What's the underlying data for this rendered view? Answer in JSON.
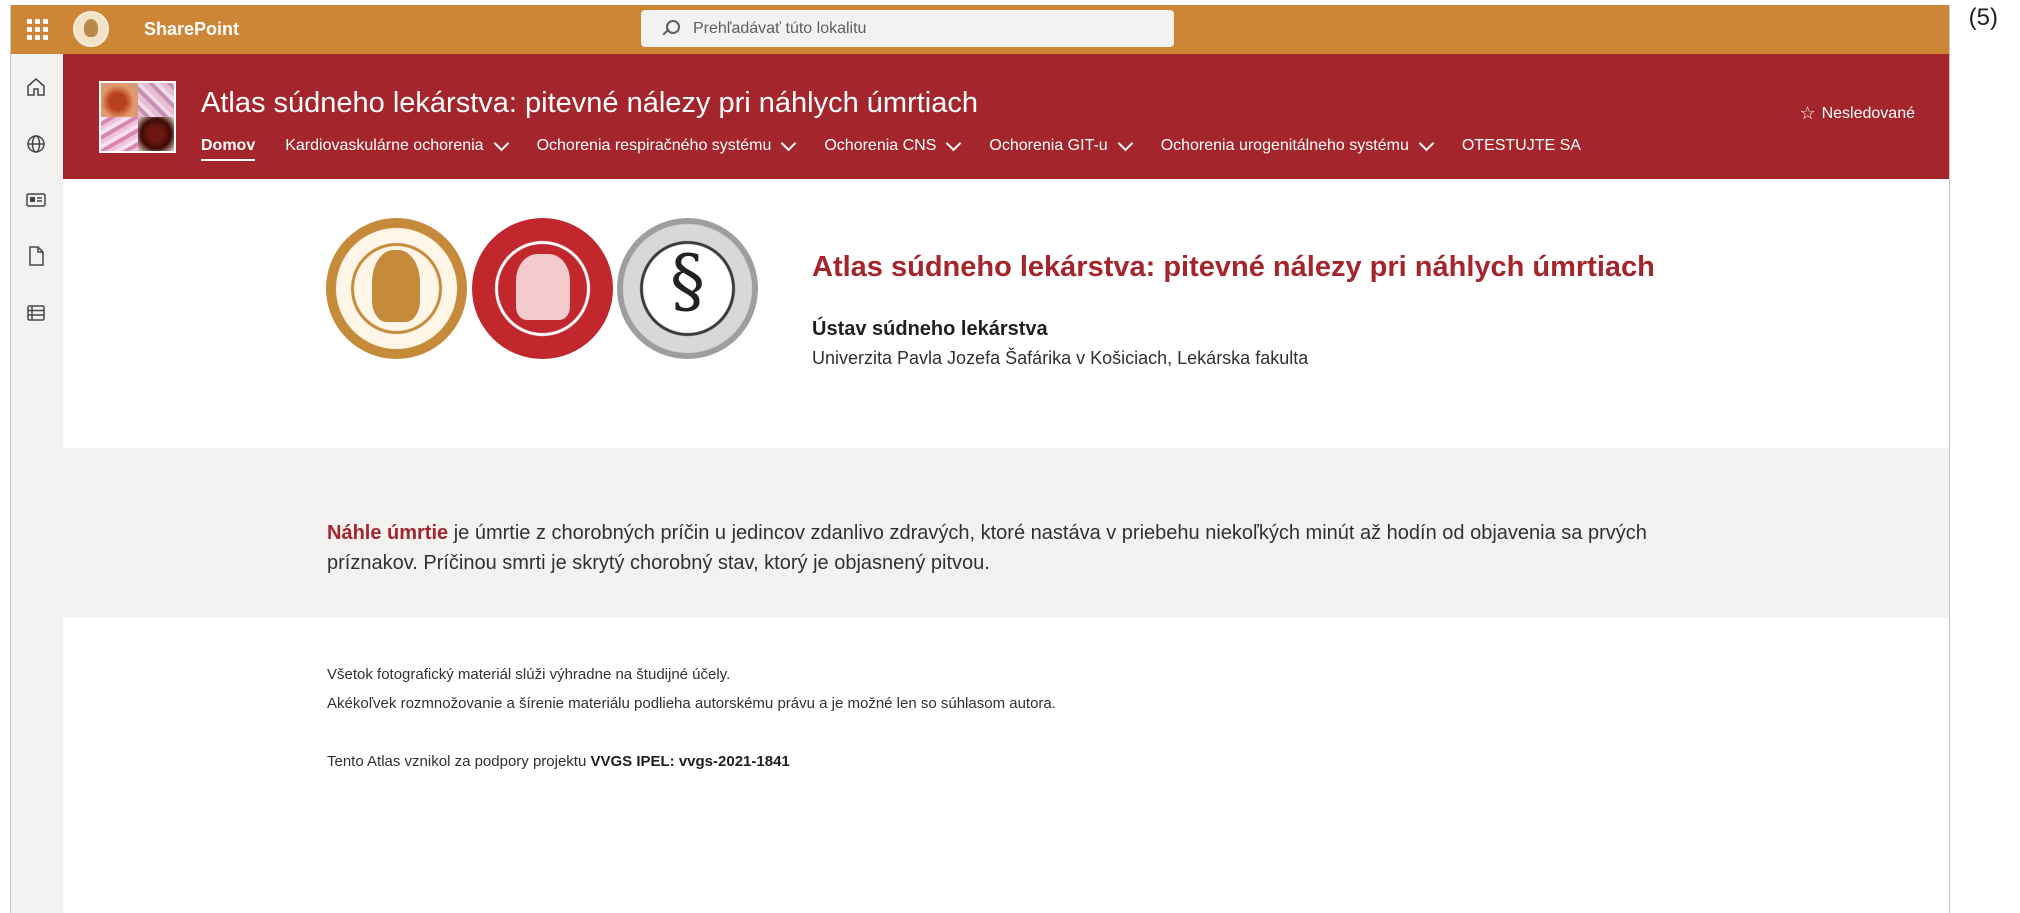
{
  "page_number": "(5)",
  "suite_bar": {
    "app_name": "SharePoint",
    "search_placeholder": "Prehľadávať túto lokalitu",
    "color": "#cd8536"
  },
  "app_bar": {
    "icons": [
      "home-icon",
      "globe-icon",
      "news-icon",
      "file-icon",
      "list-icon"
    ]
  },
  "header": {
    "site_title": "Atlas súdneho lekárstva: pitevné nálezy pri náhlych úmrtiach",
    "color": "#a4262c",
    "nav": [
      {
        "label": "Domov",
        "active": true,
        "dropdown": false
      },
      {
        "label": "Kardiovaskulárne ochorenia",
        "active": false,
        "dropdown": true
      },
      {
        "label": "Ochorenia respiračného systému",
        "active": false,
        "dropdown": true
      },
      {
        "label": "Ochorenia CNS",
        "active": false,
        "dropdown": true
      },
      {
        "label": "Ochorenia GIT-u",
        "active": false,
        "dropdown": true
      },
      {
        "label": "Ochorenia urogenitálneho systému",
        "active": false,
        "dropdown": true
      },
      {
        "label": "OTESTUJTE SA",
        "active": false,
        "dropdown": false
      }
    ],
    "follow_label": "Nesledované"
  },
  "hero": {
    "title": "Atlas súdneho lekárstva: pitevné nálezy pri náhlych úmrtiach",
    "department": "Ústav súdneho lekárstva",
    "university": "Univerzita Pavla Jozefa Šafárika v Košiciach, Lekárska fakulta"
  },
  "intro": {
    "term": "Náhle úmrtie",
    "text": " je úmrtie z chorobných príčin u jedincov zdanlivo zdravých, ktoré nastáva v priebehu niekoľkých minút až hodín od objavenia sa prvých príznakov. Príčinou smrti je skrytý chorobný stav, ktorý je objasnený pitvou."
  },
  "notes": {
    "line1": "Všetok fotografický materiál slúži výhradne na študijné účely.",
    "line2": "Akékoľvek rozmnožovanie a šírenie materiálu podlieha autorskému právu a je možné len so súhlasom autora.",
    "line3_prefix": "Tento Atlas vznikol za podpory projektu ",
    "line3_project": "VVGS IPEL: vvgs-2021-1841"
  }
}
